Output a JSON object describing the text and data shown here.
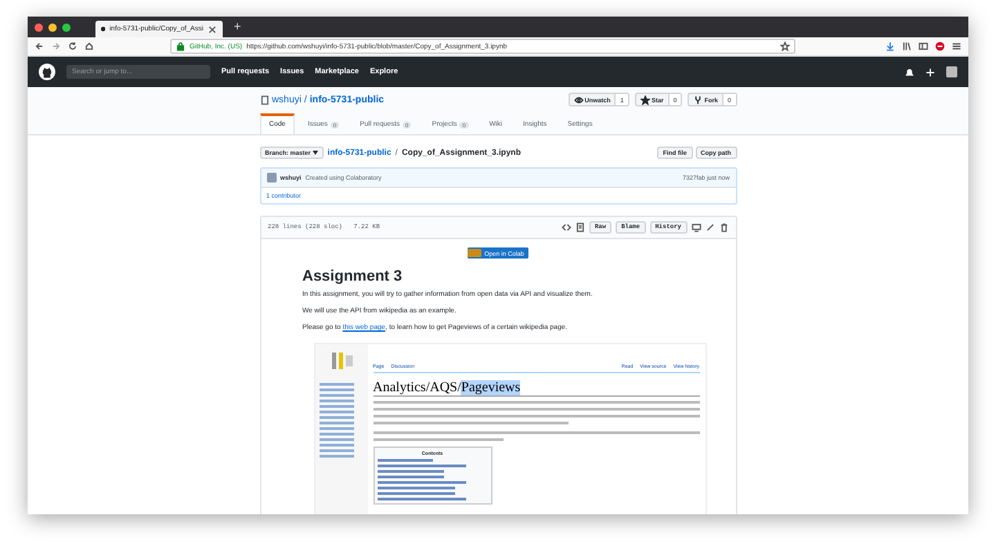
{
  "browser": {
    "tab_title": "info-5731-public/Copy_of_Assi",
    "new_tab": "+",
    "identity": "GitHub, Inc. (US)",
    "url": "https://github.com/wshuyi/info-5731-public/blob/master/Copy_of_Assignment_3.ipynb"
  },
  "header": {
    "search": {
      "placeholder": "Search or jump to..."
    },
    "nav": [
      "Pull requests",
      "Issues",
      "Marketplace",
      "Explore"
    ]
  },
  "repo": {
    "owner": "wshuyi",
    "separator": "/",
    "name": "info-5731-public",
    "actions": [
      {
        "label": "Unwatch",
        "count": "1"
      },
      {
        "label": "Star",
        "count": "0"
      },
      {
        "label": "Fork",
        "count": "0"
      }
    ],
    "tabs": [
      {
        "label": "Code",
        "selected": true
      },
      {
        "label": "Issues",
        "count": "0",
        "selected": false
      },
      {
        "label": "Pull requests",
        "count": "0",
        "selected": false
      },
      {
        "label": "Projects",
        "count": "0",
        "selected": false
      },
      {
        "label": "Wiki",
        "selected": false
      },
      {
        "label": "Insights",
        "selected": false
      },
      {
        "label": "Settings",
        "selected": false
      }
    ]
  },
  "file_nav": {
    "branch": "Branch: master",
    "repo_link": "info-5731-public",
    "separator": "/",
    "file": "Copy_of_Assignment_3.ipynb",
    "buttons": [
      "Find file",
      "Copy path"
    ]
  },
  "commit": {
    "author": "wshuyi",
    "message": "Created using Colaboratory",
    "sha": "7327fab just now",
    "contributors": "1 contributor"
  },
  "file_header": {
    "info": "228 lines (228 sloc)   7.22 KB",
    "buttons": [
      "Raw",
      "Blame",
      "History"
    ]
  },
  "notebook": {
    "badge": "Open in Colab",
    "title": "Assignment 3",
    "paragraphs": [
      {
        "text": "In this assignment, you will try to gather information from open data via API and visualize them."
      },
      {
        "text": "We will use the API from wikipedia as an example."
      },
      {
        "before": "Please go to ",
        "link": "this web page",
        "after": ", to learn how to get Pageviews of a certain wikipedia page."
      }
    ],
    "wiki": {
      "tabs": [
        "Page",
        "Discussion"
      ],
      "actions": [
        "Read",
        "View source",
        "View history"
      ],
      "title_prefix": "Analytics/AQS/",
      "title_highlight": "Pageviews",
      "contents": "Contents"
    }
  }
}
